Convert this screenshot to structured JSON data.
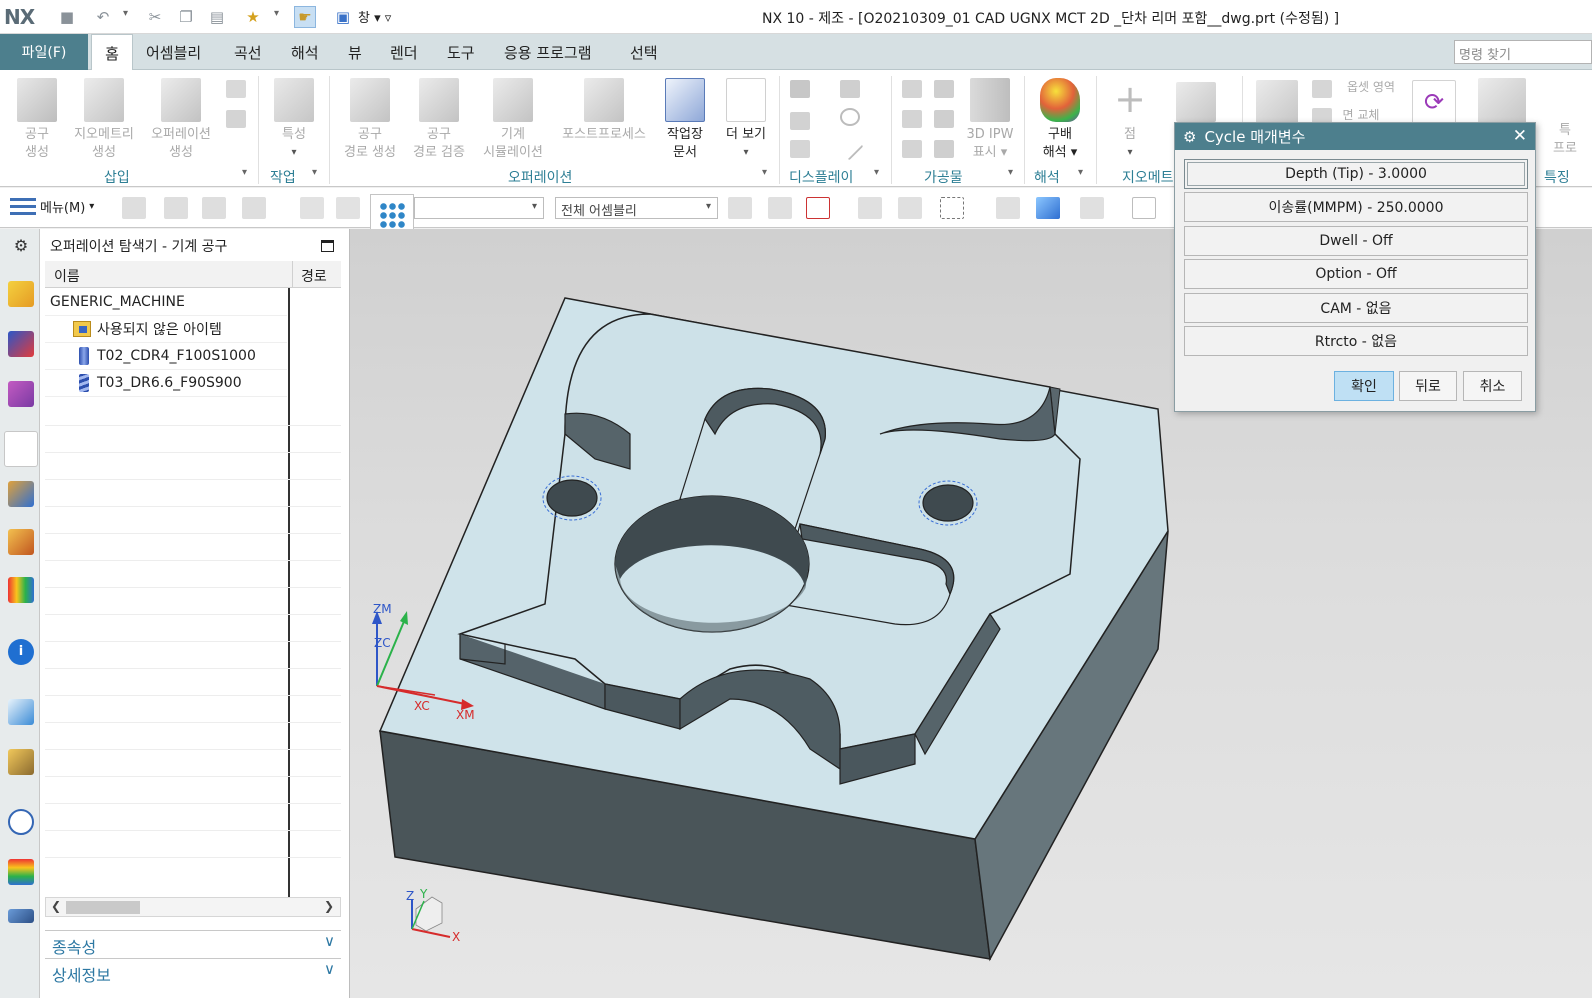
{
  "app": {
    "logo": "NX",
    "window_menu_label": "창",
    "title": "NX 10 - 제조 - [O20210309_01 CAD UGNX MCT 2D _단차 리머 포함__dwg.prt (수정됨) ]"
  },
  "menu": {
    "file": "파일(F)",
    "tabs": [
      "홈",
      "어셈블리",
      "곡선",
      "해석",
      "뷰",
      "렌더",
      "도구",
      "응용 프로그램",
      "선택"
    ],
    "command_finder_placeholder": "명령 찾기"
  },
  "ribbon": {
    "buttons": {
      "create_tool": [
        "공구",
        "생성"
      ],
      "create_geometry": [
        "지오메트리",
        "생성"
      ],
      "create_operation": [
        "오퍼레이션",
        "생성"
      ],
      "properties": "특성",
      "generate_path": [
        "공구",
        "경로 생성"
      ],
      "verify_path": [
        "공구",
        "경로 검증"
      ],
      "machine_sim": [
        "기계",
        "시뮬레이션"
      ],
      "postprocess": "포스트프로세스",
      "shop_doc": [
        "작업장",
        "문서"
      ],
      "more": "더 보기",
      "ipw_3d": [
        "3D IPW",
        "표시"
      ],
      "gradient": [
        "구배",
        "해석"
      ],
      "point": "점",
      "face_region": "옵셋 영역",
      "replace_face": "면 교체"
    },
    "groups": {
      "insert": "삽입",
      "job": "작업",
      "operation": "오퍼레이션",
      "display": "디스플레이",
      "workpiece": "가공물",
      "analysis": "해석",
      "geometry": "지오메트",
      "feature": "특징"
    }
  },
  "toolbar2": {
    "menu_label": "메뉴(M)",
    "filter_dropdown": "",
    "assembly_dropdown": "전체 어셈블리"
  },
  "navigator": {
    "title": "오퍼레이션 탐색기 - 기계 공구",
    "columns": {
      "name": "이름",
      "path": "경로"
    },
    "rows": [
      {
        "label": "GENERIC_MACHINE",
        "level": 0,
        "icon": "none"
      },
      {
        "label": "사용되지 않은 아이템",
        "level": 1,
        "icon": "folder-icon"
      },
      {
        "label": "T02_CDR4_F100S1000",
        "level": 1,
        "icon": "tool-icon"
      },
      {
        "label": "T03_DR6.6_F90S900",
        "level": 1,
        "icon": "tool-icon"
      }
    ],
    "panels": {
      "dependencies": "종속성",
      "details": "상세정보"
    }
  },
  "graphics": {
    "wcs_labels": {
      "zm": "ZM",
      "zc": "ZC",
      "xc": "XC",
      "xm": "XM"
    },
    "triad_labels": {
      "x": "X",
      "y": "Y",
      "z": "Z"
    }
  },
  "dialog": {
    "title": "Cycle 매개변수",
    "params": [
      "Depth (Tip) - 3.0000",
      "이송률(MMPM) - 250.0000",
      "Dwell - Off",
      "Option - Off",
      "CAM - 없음",
      "Rtrcto - 없음"
    ],
    "buttons": {
      "ok": "확인",
      "back": "뒤로",
      "cancel": "취소"
    }
  },
  "colors": {
    "accent": "#4d7f8d",
    "ribbon_group_label": "#2e7f95",
    "part_top": "#cfe3ea",
    "part_side_dark": "#4a5559",
    "part_side_mid": "#6b7a80"
  }
}
